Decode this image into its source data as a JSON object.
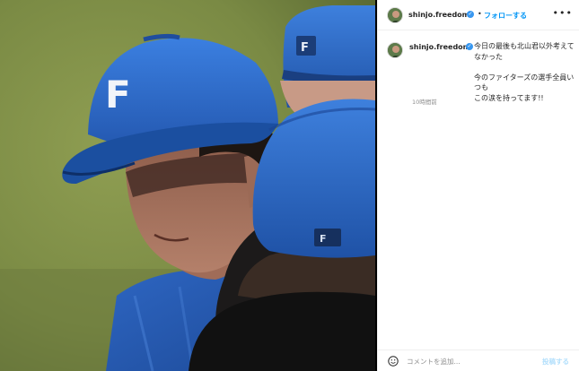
{
  "post": {
    "username": "shinjo.freedom",
    "separator": "•",
    "follow_label": "フォローする",
    "more_icon": "more-options-icon",
    "verified_icon": "verified-badge-icon"
  },
  "caption": {
    "username": "shinjo.freedom",
    "text": "今日の最後も北山君以外考えて\nなかった\n\n今のファイターズの選手全員いつも\nこの涙を持ってます!!",
    "time": "10時間前"
  },
  "comment_box": {
    "placeholder": "コメントを追加...",
    "post_label": "投稿する",
    "emoji_icon": "emoji-icon"
  },
  "photo": {
    "cap_logo": "F"
  },
  "colors": {
    "accent": "#0095f6",
    "verified": "#3897f0",
    "post_disabled": "#b2dffc",
    "cap_blue": "#2f6fd0"
  }
}
